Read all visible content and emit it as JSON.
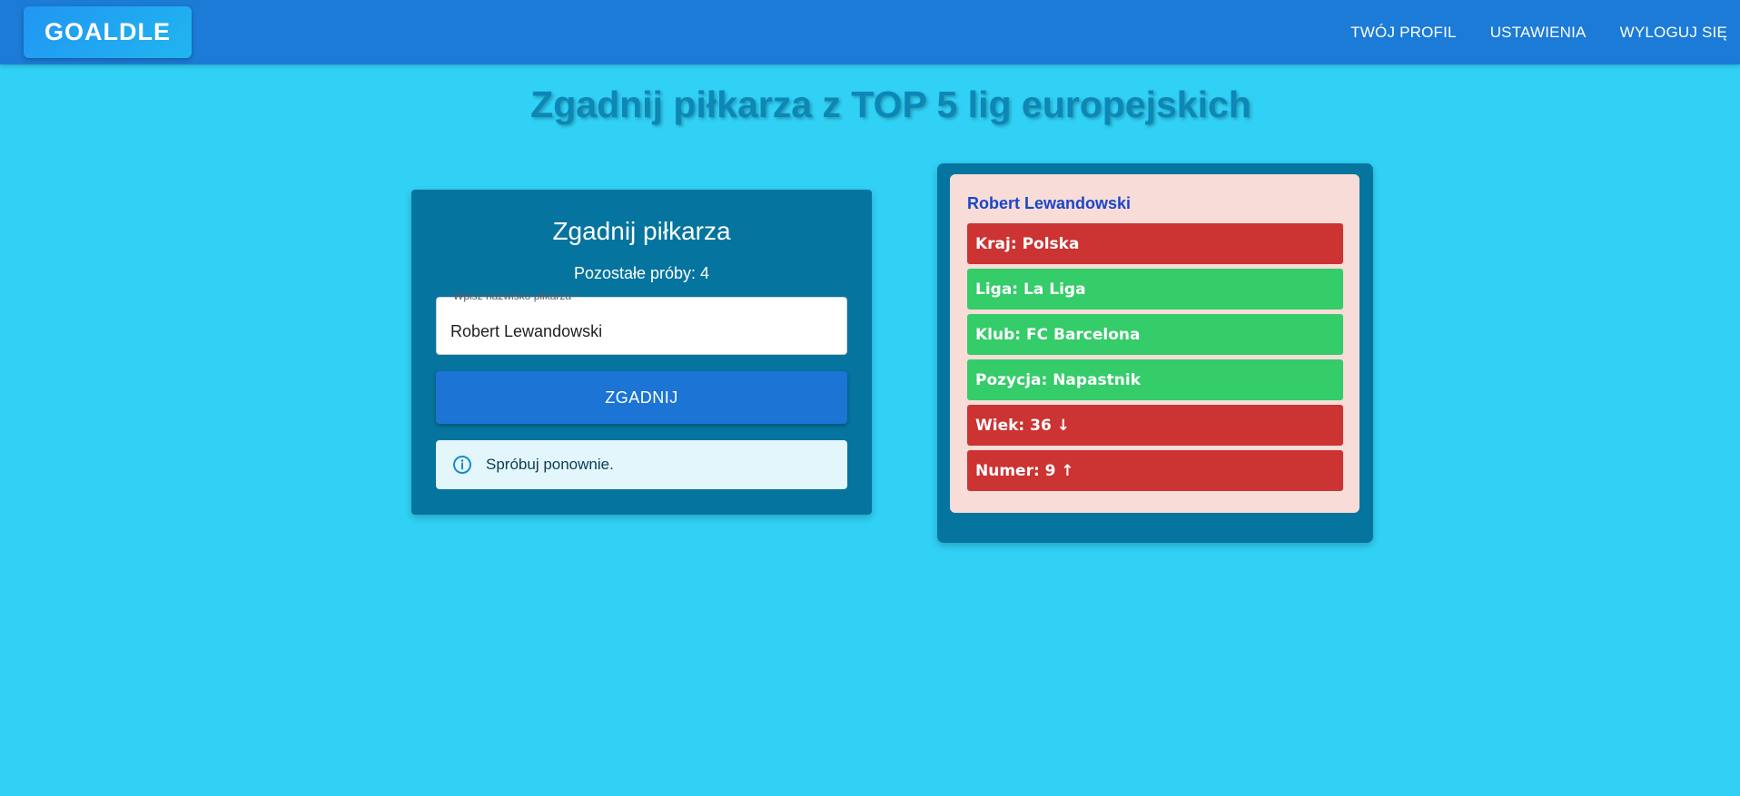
{
  "app": {
    "logo": "GOALDLE",
    "nav": [
      "TWÓJ PROFIL",
      "USTAWIENIA",
      "WYLOGUJ SIĘ"
    ]
  },
  "page": {
    "headline": "Zgadnij piłkarza z TOP 5 lig europejskich"
  },
  "guess_form": {
    "title": "Zgadnij piłkarza",
    "attempts": "Pozostałe próby: 4",
    "input_label": "Wpisz nazwisko piłkarza *",
    "input_value": "Robert Lewandowski",
    "submit_label": "ZGADNIJ",
    "alert_text": "Spróbuj ponownie.",
    "alert_icon": "info-icon"
  },
  "result": {
    "player": "Robert Lewandowski",
    "attributes": [
      {
        "text": "Kraj: Polska",
        "status": "wrong"
      },
      {
        "text": "Liga: La Liga",
        "status": "right"
      },
      {
        "text": "Klub: FC Barcelona",
        "status": "right"
      },
      {
        "text": "Pozycja: Napastnik",
        "status": "right"
      },
      {
        "text": "Wiek: 36 ↓",
        "status": "wrong"
      },
      {
        "text": "Numer: 9 ↑",
        "status": "wrong"
      }
    ]
  },
  "colors": {
    "background": "#31d0f5",
    "appbar": "#1c7bd6",
    "card": "#05749e",
    "correct": "#35cc6a",
    "incorrect": "#cc3333",
    "result_card": "#f8dcd8"
  }
}
